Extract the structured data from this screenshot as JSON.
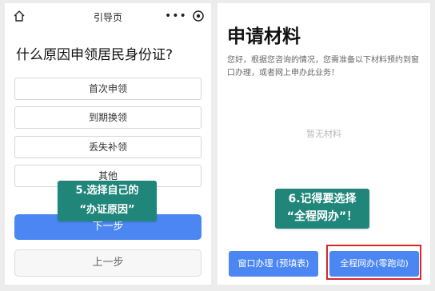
{
  "left": {
    "nav_title": "引导页",
    "capsule_dots": "•••",
    "question": "什么原因申领居民身份证?",
    "options": [
      "首次申领",
      "到期换领",
      "丢失补领",
      "其他"
    ],
    "next_label": "下一步",
    "prev_label": "上一步",
    "callout": {
      "line1": "5.选择自己的",
      "line2": "“办证原因”"
    }
  },
  "right": {
    "title": "申请材料",
    "description": "您好，根据您咨询的情况，您需准备以下材料预约到窗口办理，或者网上申办此业务！",
    "empty_text": "暂无材料",
    "callout": {
      "line1": "6.记得要选择",
      "line2": "“全程网办”！"
    },
    "window_button": "窗口办理 (预填表)",
    "online_button": "全程网办(零跑动)"
  },
  "colors": {
    "primary": "#4b86f2",
    "callout": "#20867a",
    "highlight": "#d8262b"
  }
}
